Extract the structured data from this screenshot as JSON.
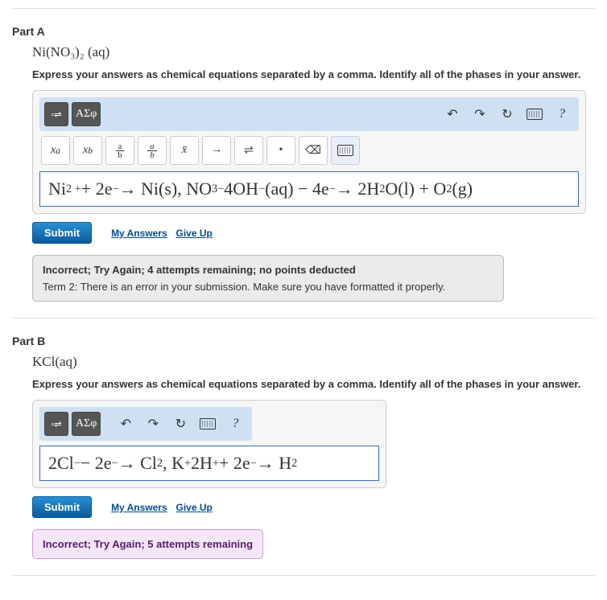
{
  "partA": {
    "title": "Part A",
    "formula": "Ni(NO₃)₂ (aq)",
    "instructions": "Express your answers as chemical equations separated by a comma. Identify all of the phases in your answer.",
    "toolbar": {
      "template_btn": "▫⇌",
      "greek_btn": "ΑΣφ",
      "undo": "↶",
      "redo": "↷",
      "reset": "↻",
      "keyboard": "kbd",
      "help": "?"
    },
    "symbols": {
      "sup": "xᵃ",
      "sub": "xᵦ",
      "frac_small_num": "a",
      "frac_small_den": "b",
      "xbar": "x̄",
      "arrow": "→",
      "equil": "⇌",
      "dot": "•",
      "backspace": "⌫"
    },
    "answer_html": "Ni<sup>2 +</sup> + 2e<sup>−</sup> → Ni(s), NO<sub>3</sub><sup>−</sup> 4OH<sup>−</sup>(aq) − 4e<sup>−</sup> → 2H<sub>2</sub> O(l) + O<sub>2</sub> (g)",
    "submit": "Submit",
    "my_answers": "My Answers",
    "give_up": "Give Up",
    "feedback_title": "Incorrect; Try Again; 4 attempts remaining; no points deducted",
    "feedback_body": "Term 2: There is an error in your submission. Make sure you have formatted it properly."
  },
  "partB": {
    "title": "Part B",
    "formula": "KCl(aq)",
    "instructions": "Express your answers as chemical equations separated by a comma. Identify all of the phases in your answer.",
    "toolbar": {
      "template_btn": "▫⇌",
      "greek_btn": "ΑΣφ",
      "undo": "↶",
      "redo": "↷",
      "reset": "↻",
      "keyboard": "kbd",
      "help": "?"
    },
    "answer_html": "2Cl<sup>−</sup> − 2e<sup>−</sup> → Cl<sub>2</sub> , K<sup>+</sup> 2H<sup>+</sup> + 2e<sup>−</sup> → H<sub>2</sub>",
    "submit": "Submit",
    "my_answers": "My Answers",
    "give_up": "Give Up",
    "feedback_title": "Incorrect; Try Again; 5 attempts remaining"
  }
}
